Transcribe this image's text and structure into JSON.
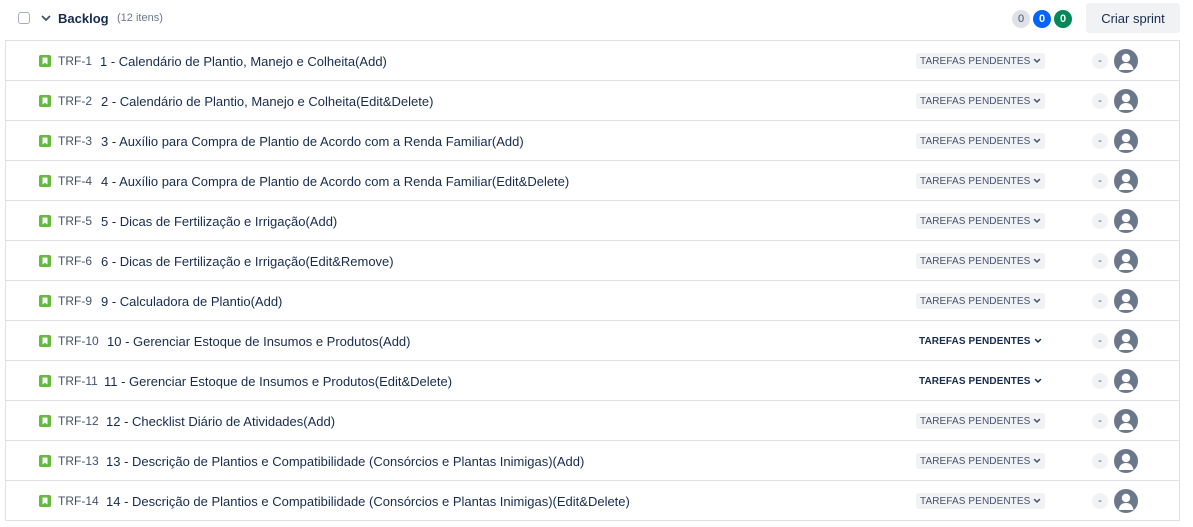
{
  "backlog": {
    "title": "Backlog",
    "count": "(12 itens)",
    "pills": [
      "0",
      "0",
      "0"
    ],
    "create_sprint_label": "Criar sprint"
  },
  "colors": {
    "story": "#63ba3c",
    "pill_blue": "#0065ff",
    "pill_green": "#00875a"
  },
  "issues": [
    {
      "key": "TRF-1",
      "summary": "1 - Calendário de Plantio, Manejo e Colheita(Add)",
      "status": "TAREFAS PENDENTES",
      "estimate": "-",
      "status_emphasis": false
    },
    {
      "key": "TRF-2",
      "summary": "2 - Calendário de Plantio, Manejo e Colheita(Edit&Delete)",
      "status": "TAREFAS PENDENTES",
      "estimate": "-",
      "status_emphasis": false
    },
    {
      "key": "TRF-3",
      "summary": "3 - Auxílio para Compra de Plantio de Acordo com a Renda Familiar(Add)",
      "status": "TAREFAS PENDENTES",
      "estimate": "-",
      "status_emphasis": false
    },
    {
      "key": "TRF-4",
      "summary": "4 - Auxílio para Compra de Plantio de Acordo com a Renda Familiar(Edit&Delete)",
      "status": "TAREFAS PENDENTES",
      "estimate": "-",
      "status_emphasis": false
    },
    {
      "key": "TRF-5",
      "summary": "5 - Dicas de Fertilização e Irrigação(Add)",
      "status": "TAREFAS PENDENTES",
      "estimate": "-",
      "status_emphasis": false
    },
    {
      "key": "TRF-6",
      "summary": "6 - Dicas de Fertilização e Irrigação(Edit&Remove)",
      "status": "TAREFAS PENDENTES",
      "estimate": "-",
      "status_emphasis": false
    },
    {
      "key": "TRF-9",
      "summary": "9 - Calculadora de Plantio(Add)",
      "status": "TAREFAS PENDENTES",
      "estimate": "-",
      "status_emphasis": false
    },
    {
      "key": "TRF-10",
      "summary": "10 - Gerenciar Estoque de Insumos e Produtos(Add)",
      "status": "TAREFAS PENDENTES",
      "estimate": "-",
      "status_emphasis": true
    },
    {
      "key": "TRF-11",
      "summary": "11 - Gerenciar Estoque de Insumos e Produtos(Edit&Delete)",
      "status": "TAREFAS PENDENTES",
      "estimate": "-",
      "status_emphasis": true
    },
    {
      "key": "TRF-12",
      "summary": "12 - Checklist Diário de Atividades(Add)",
      "status": "TAREFAS PENDENTES",
      "estimate": "-",
      "status_emphasis": false
    },
    {
      "key": "TRF-13",
      "summary": "13 - Descrição de Plantios e Compatibilidade (Consórcios e Plantas Inimigas)(Add)",
      "status": "TAREFAS PENDENTES",
      "estimate": "-",
      "status_emphasis": false
    },
    {
      "key": "TRF-14",
      "summary": "14 - Descrição de Plantios e Compatibilidade (Consórcios e Plantas Inimigas)(Edit&Delete)",
      "status": "TAREFAS PENDENTES",
      "estimate": "-",
      "status_emphasis": false
    }
  ]
}
